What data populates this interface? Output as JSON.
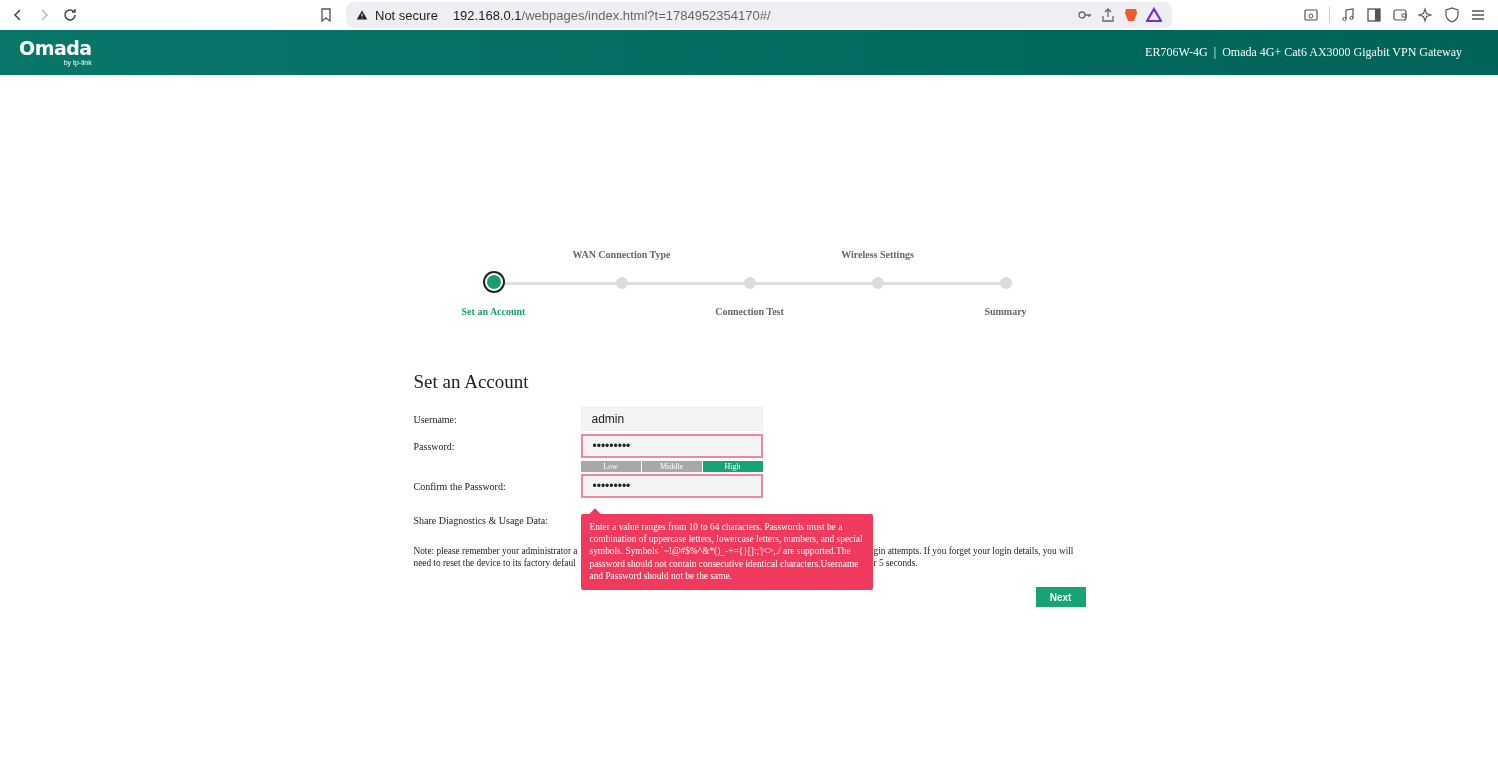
{
  "browser": {
    "security": "Not secure",
    "url_host": "192.168.0.1",
    "url_path": "/webpages/index.html?t=1784952354170#/"
  },
  "header": {
    "logo": "Omada",
    "logo_sub": "by tp-link",
    "model": "ER706W-4G",
    "separator": "|",
    "product": "Omada 4G+ Cat6 AX3000 Gigabit VPN Gateway"
  },
  "steps": [
    {
      "label": "Set an Account",
      "selected": true
    },
    {
      "label": "WAN Connection Type",
      "selected": false
    },
    {
      "label": "Connection Test",
      "selected": false
    },
    {
      "label": "Wireless Settings",
      "selected": false
    },
    {
      "label": "Summary",
      "selected": false
    }
  ],
  "form": {
    "title": "Set an Account",
    "fields": [
      {
        "kind": "text",
        "label": "Username:",
        "value": "admin",
        "error": false
      },
      {
        "kind": "password",
        "label": "Password:",
        "value": "•••••••••",
        "error": true
      },
      {
        "kind": "strength",
        "segments": [
          {
            "label": "Low",
            "active": false
          },
          {
            "label": "Middle",
            "active": false
          },
          {
            "label": "High",
            "active": true
          }
        ]
      },
      {
        "kind": "password",
        "label": "Confirm the Password:",
        "value": "•••••••••",
        "error": true
      },
      {
        "kind": "toggle",
        "label": "Share Diagnostics & Usage Data:"
      }
    ],
    "note_lines": [
      {
        "left": "Note: please remember your administrator a",
        "right": "gin attempts. If you forget your login details, you will"
      },
      {
        "left": "need to reset the device to its factory defaul",
        "right": "r 5 seconds."
      }
    ],
    "tooltip": "Enter a value ranges from 10 to 64 characters. Passwords must be a combination of uppercase letters, lowercase letters, numbers, and special symbols. Symbols `~!@#$%^&*()_-+={}[]:;'|<>,./ are supported.The password should not contain consecutive identical characters.Username and Password should not be the same.",
    "next": "Next"
  }
}
